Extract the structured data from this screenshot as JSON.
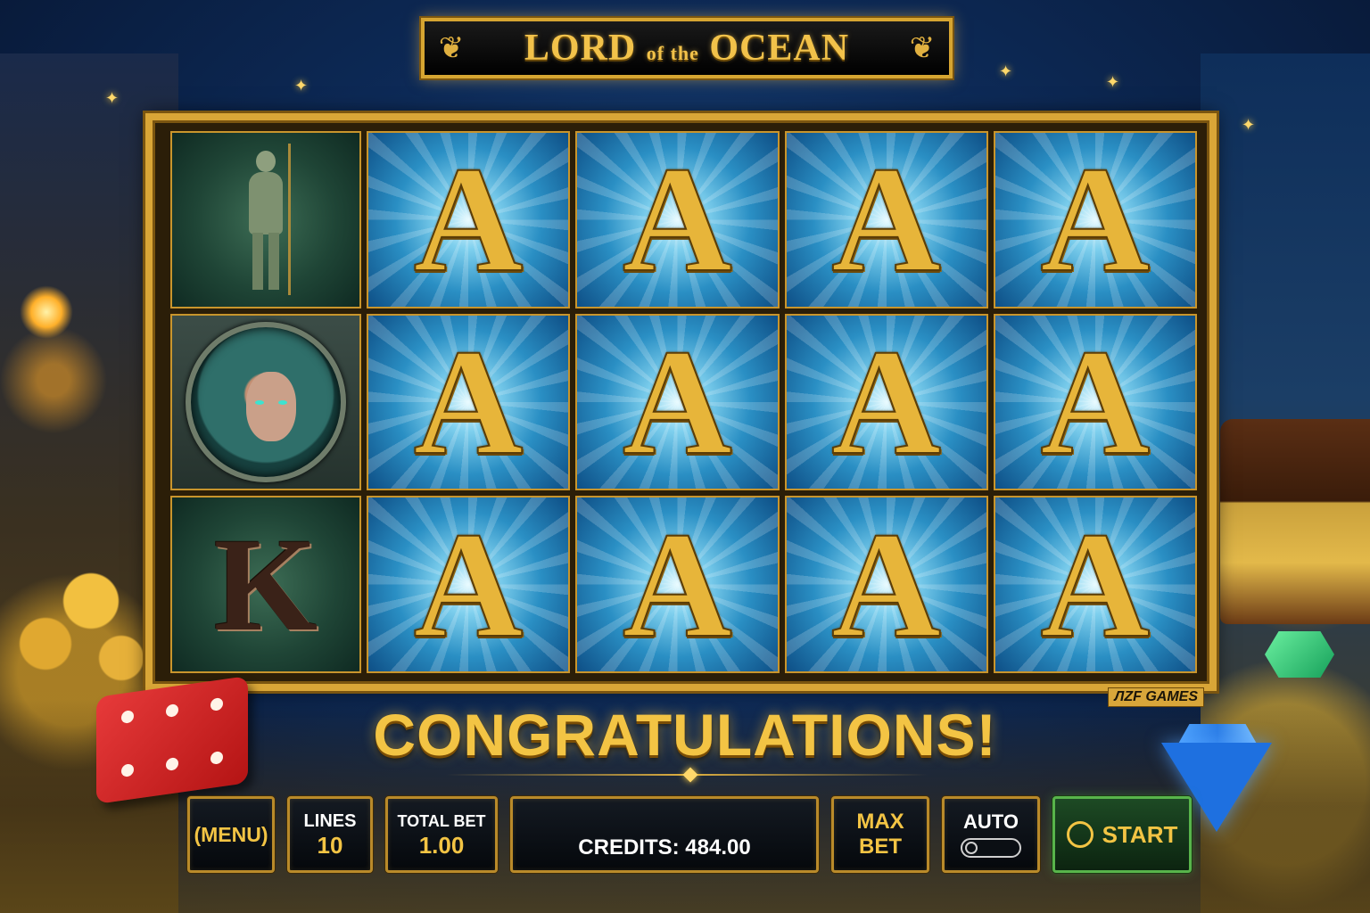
{
  "game": {
    "title_main_1": "LORD",
    "title_small": "of the",
    "title_main_2": "OCEAN",
    "brand": "ЛZF GAMES"
  },
  "reels": {
    "grid": [
      [
        "statue",
        "A",
        "A",
        "A",
        "A"
      ],
      [
        "mermaid",
        "A",
        "A",
        "A",
        "A"
      ],
      [
        "K",
        "A",
        "A",
        "A",
        "A"
      ]
    ],
    "symbol_a": "A",
    "symbol_k": "K"
  },
  "message": {
    "congrats": "CONGRATULATIONS!"
  },
  "controls": {
    "menu_label": "(MENU)",
    "lines_label": "LINES",
    "lines_value": "10",
    "total_bet_label": "TOTAL BET",
    "total_bet_value": "1.00",
    "credits_text": "CREDITS: 484.00",
    "max_bet_line1": "MAX",
    "max_bet_line2": "BET",
    "auto_label": "AUTO",
    "start_label": "START"
  },
  "colors": {
    "gold": "#f3c444",
    "frame": "#d9a637",
    "start_green": "#58b44b"
  }
}
